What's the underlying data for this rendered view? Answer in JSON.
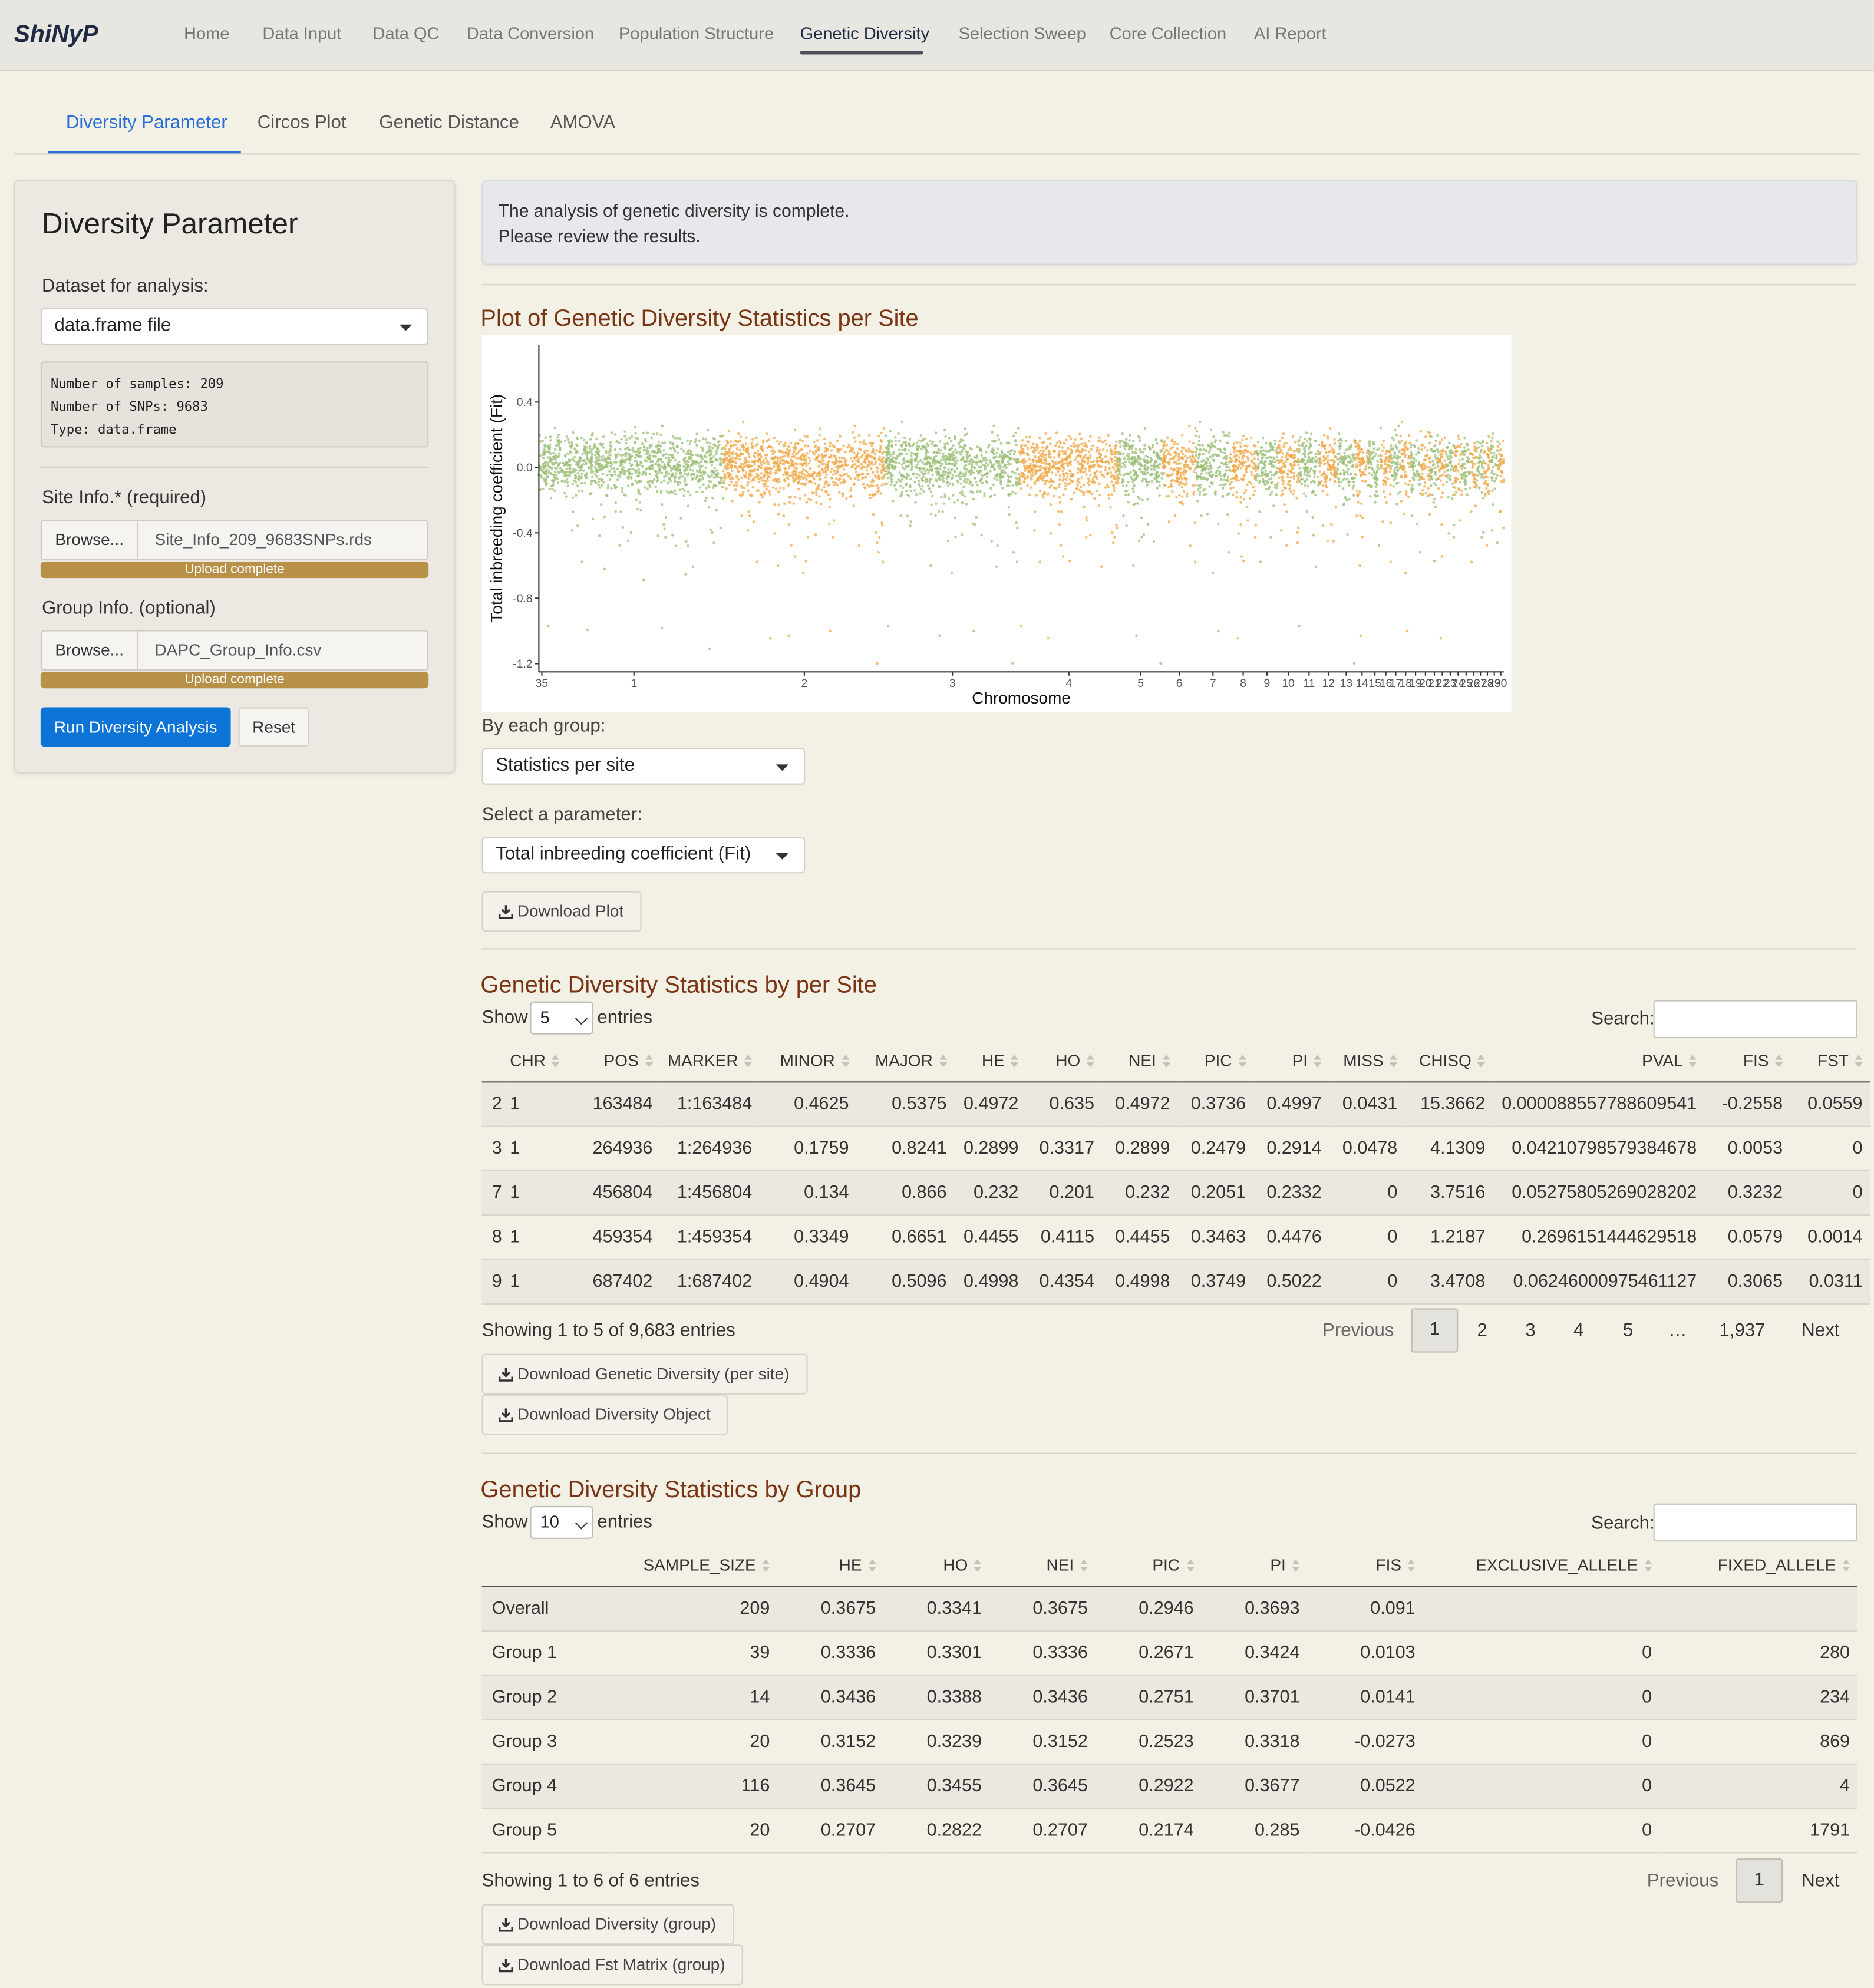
{
  "app": {
    "brand": "ShiNyP"
  },
  "nav": {
    "items": [
      "Home",
      "Data Input",
      "Data QC",
      "Data Conversion",
      "Population Structure",
      "Genetic Diversity",
      "Selection Sweep",
      "Core Collection",
      "AI Report"
    ],
    "active": "Genetic Diversity"
  },
  "subtabs": {
    "items": [
      "Diversity Parameter",
      "Circos Plot",
      "Genetic Distance",
      "AMOVA"
    ],
    "active": "Diversity Parameter"
  },
  "sidebar": {
    "title": "Diversity Parameter",
    "dataset_label": "Dataset for analysis:",
    "dataset_value": "data.frame file",
    "info_lines": [
      "Number of samples: 209",
      "Number of SNPs: 9683",
      "Type: data.frame"
    ],
    "site_label": "Site Info.* (required)",
    "site_browse": "Browse...",
    "site_file": "Site_Info_209_9683SNPs.rds",
    "site_progress": "Upload complete",
    "group_label": "Group Info. (optional)",
    "group_browse": "Browse...",
    "group_file": "DAPC_Group_Info.csv",
    "group_progress": "Upload complete",
    "run_button": "Run Diversity Analysis",
    "reset_button": "Reset"
  },
  "alert": {
    "line1": "The analysis of genetic diversity is complete.",
    "line2": "Please review the results."
  },
  "plot_section": {
    "title": "Plot of Genetic Diversity Statistics per Site",
    "group_label": "By each group:",
    "group_value": "Statistics per site",
    "param_label": "Select a parameter:",
    "param_value": "Total inbreeding coefficient (Fit)",
    "download": "Download Plot"
  },
  "chart_data": {
    "type": "scatter",
    "title": "",
    "xlabel": "Chromosome",
    "ylabel": "Total inbreeding coefficient (Fit)",
    "ylim": [
      -1.25,
      0.75
    ],
    "y_ticks": [
      "0.4",
      "0.0",
      "-0.4",
      "-0.8",
      "-1.2"
    ],
    "y_tick_values": [
      0.4,
      0.0,
      -0.4,
      -0.8,
      -1.2
    ],
    "x_tick_labels": [
      "35",
      "1",
      "2",
      "3",
      "4",
      "5",
      "6",
      "7",
      "8",
      "9",
      "10",
      "11",
      "12",
      "13",
      "14",
      "15",
      "16",
      "17",
      "18",
      "19",
      "20",
      "21",
      "22",
      "23",
      "24",
      "25",
      "26",
      "27",
      "28",
      "29",
      "30"
    ],
    "colors": {
      "odd": "#9cbf78",
      "even": "#f0a848"
    },
    "grid": false,
    "legend": "none",
    "chromosome_spans": [
      {
        "chr": "35",
        "start": 0,
        "end": 0.6
      },
      {
        "chr": "1",
        "start": 0.6,
        "end": 18.6
      },
      {
        "chr": "2",
        "start": 18.6,
        "end": 35.0
      },
      {
        "chr": "3",
        "start": 35.0,
        "end": 48.5
      },
      {
        "chr": "4",
        "start": 48.5,
        "end": 58.5
      },
      {
        "chr": "5",
        "start": 58.5,
        "end": 63.0
      },
      {
        "chr": "6",
        "start": 63.0,
        "end": 66.3
      },
      {
        "chr": "7",
        "start": 66.3,
        "end": 69.8
      },
      {
        "chr": "8",
        "start": 69.8,
        "end": 72.4
      },
      {
        "chr": "9",
        "start": 72.4,
        "end": 74.6
      },
      {
        "chr": "10",
        "start": 74.6,
        "end": 76.7
      },
      {
        "chr": "11",
        "start": 76.7,
        "end": 78.8
      },
      {
        "chr": "12",
        "start": 78.8,
        "end": 80.6
      },
      {
        "chr": "13",
        "start": 80.6,
        "end": 82.4
      },
      {
        "chr": "14",
        "start": 82.4,
        "end": 83.8
      },
      {
        "chr": "15",
        "start": 83.8,
        "end": 85.0
      },
      {
        "chr": "16",
        "start": 85.0,
        "end": 86.0
      },
      {
        "chr": "17",
        "start": 86.0,
        "end": 87.0
      },
      {
        "chr": "18",
        "start": 87.0,
        "end": 88.0
      },
      {
        "chr": "19",
        "start": 88.0,
        "end": 89.0
      },
      {
        "chr": "20",
        "start": 89.0,
        "end": 90.0
      },
      {
        "chr": "21",
        "start": 90.0,
        "end": 90.8
      },
      {
        "chr": "22",
        "start": 90.8,
        "end": 91.6
      },
      {
        "chr": "23",
        "start": 91.6,
        "end": 92.4
      },
      {
        "chr": "24",
        "start": 92.4,
        "end": 93.2
      },
      {
        "chr": "25",
        "start": 93.2,
        "end": 94.0
      },
      {
        "chr": "26",
        "start": 94.0,
        "end": 94.7
      },
      {
        "chr": "27",
        "start": 94.7,
        "end": 95.4
      },
      {
        "chr": "28",
        "start": 95.4,
        "end": 96.1
      },
      {
        "chr": "29",
        "start": 96.1,
        "end": 96.8
      },
      {
        "chr": "30",
        "start": 96.8,
        "end": 97.4
      }
    ],
    "x_range": [
      0,
      97.4
    ]
  },
  "site_table": {
    "title": "Genetic Diversity Statistics by per Site",
    "show": "Show",
    "entries": "entries",
    "length": "5",
    "search_label": "Search:",
    "columns": [
      "",
      "CHR",
      "POS",
      "MARKER",
      "MINOR",
      "MAJOR",
      "HE",
      "HO",
      "NEI",
      "PIC",
      "PI",
      "MISS",
      "CHISQ",
      "PVAL",
      "FIS",
      "FST"
    ],
    "rows": [
      [
        "2",
        "1",
        "163484",
        "1:163484",
        "0.4625",
        "0.5375",
        "0.4972",
        "0.635",
        "0.4972",
        "0.3736",
        "0.4997",
        "0.0431",
        "15.3662",
        "0.000088557788609541",
        "-0.2558",
        "0.0559"
      ],
      [
        "3",
        "1",
        "264936",
        "1:264936",
        "0.1759",
        "0.8241",
        "0.2899",
        "0.3317",
        "0.2899",
        "0.2479",
        "0.2914",
        "0.0478",
        "4.1309",
        "0.04210798579384678",
        "0.0053",
        "0"
      ],
      [
        "7",
        "1",
        "456804",
        "1:456804",
        "0.134",
        "0.866",
        "0.232",
        "0.201",
        "0.232",
        "0.2051",
        "0.2332",
        "0",
        "3.7516",
        "0.05275805269028202",
        "0.3232",
        "0"
      ],
      [
        "8",
        "1",
        "459354",
        "1:459354",
        "0.3349",
        "0.6651",
        "0.4455",
        "0.4115",
        "0.4455",
        "0.3463",
        "0.4476",
        "0",
        "1.2187",
        "0.2696151444629518",
        "0.0579",
        "0.0014"
      ],
      [
        "9",
        "1",
        "687402",
        "1:687402",
        "0.4904",
        "0.5096",
        "0.4998",
        "0.4354",
        "0.4998",
        "0.3749",
        "0.5022",
        "0",
        "3.4708",
        "0.06246000975461127",
        "0.3065",
        "0.0311"
      ]
    ],
    "info": "Showing 1 to 5 of 9,683 entries",
    "pagination": {
      "previous": "Previous",
      "pages": [
        "1",
        "2",
        "3",
        "4",
        "5",
        "…",
        "1,937"
      ],
      "next": "Next"
    },
    "download1": "Download Genetic Diversity (per site)",
    "download2": "Download Diversity Object"
  },
  "group_table": {
    "title": "Genetic Diversity Statistics by Group",
    "show": "Show",
    "entries": "entries",
    "length": "10",
    "search_label": "Search:",
    "columns": [
      "",
      "SAMPLE_SIZE",
      "HE",
      "HO",
      "NEI",
      "PIC",
      "PI",
      "FIS",
      "EXCLUSIVE_ALLELE",
      "FIXED_ALLELE"
    ],
    "rows": [
      [
        "Overall",
        "209",
        "0.3675",
        "0.3341",
        "0.3675",
        "0.2946",
        "0.3693",
        "0.091",
        "",
        ""
      ],
      [
        "Group 1",
        "39",
        "0.3336",
        "0.3301",
        "0.3336",
        "0.2671",
        "0.3424",
        "0.0103",
        "0",
        "280"
      ],
      [
        "Group 2",
        "14",
        "0.3436",
        "0.3388",
        "0.3436",
        "0.2751",
        "0.3701",
        "0.0141",
        "0",
        "234"
      ],
      [
        "Group 3",
        "20",
        "0.3152",
        "0.3239",
        "0.3152",
        "0.2523",
        "0.3318",
        "-0.0273",
        "0",
        "869"
      ],
      [
        "Group 4",
        "116",
        "0.3645",
        "0.3455",
        "0.3645",
        "0.2922",
        "0.3677",
        "0.0522",
        "0",
        "4"
      ],
      [
        "Group 5",
        "20",
        "0.2707",
        "0.2822",
        "0.2707",
        "0.2174",
        "0.285",
        "-0.0426",
        "0",
        "1791"
      ]
    ],
    "info": "Showing 1 to 6 of 6 entries",
    "pagination": {
      "previous": "Previous",
      "pages": [
        "1"
      ],
      "next": "Next"
    },
    "download1": "Download Diversity (group)",
    "download2": "Download Fst Matrix (group)"
  }
}
